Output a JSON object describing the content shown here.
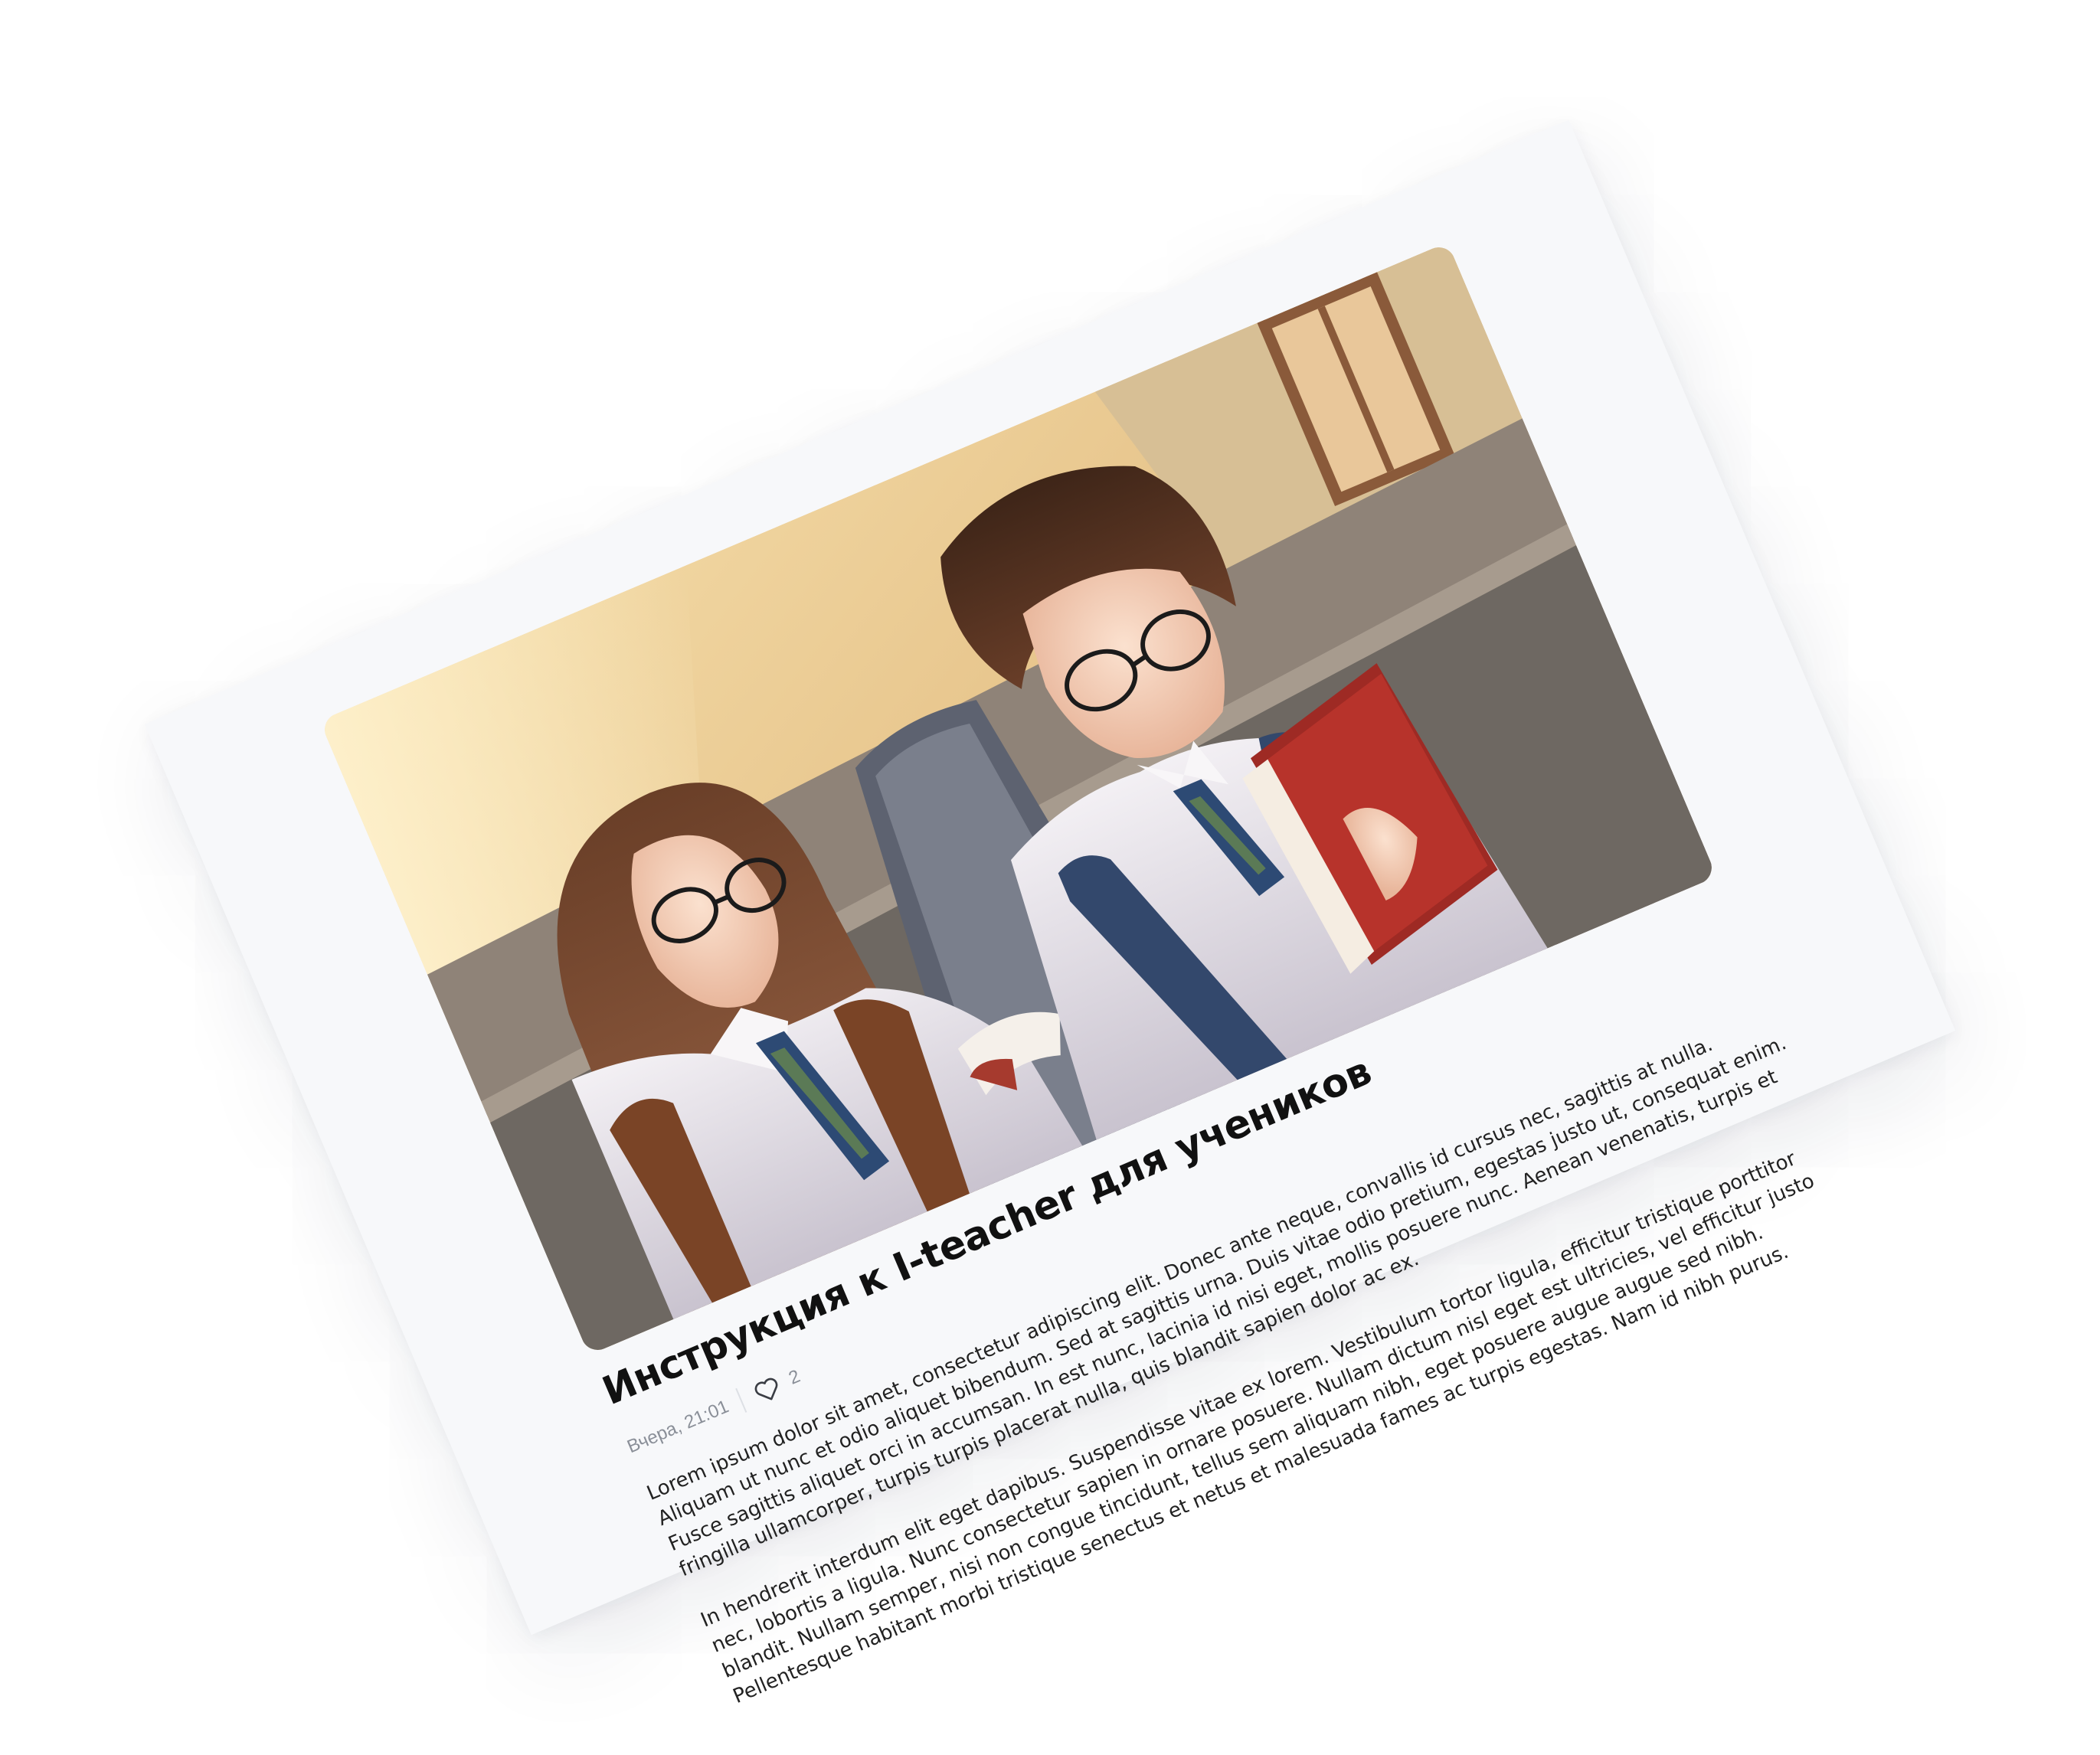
{
  "article": {
    "title": "Инструкция к I-teacher для учеников",
    "date": "Вчера, 21:01",
    "likes_count": "2",
    "paragraphs": [
      "Lorem ipsum dolor sit amet, consectetur adipiscing elit. Donec ante neque, convallis id cursus nec, sagittis at nulla. Aliquam ut nunc et odio aliquet bibendum. Sed at sagittis urna. Duis vitae odio pretium, egestas justo ut, consequat enim. Fusce sagittis aliquet orci in accumsan. In est nunc, lacinia id nisi eget, mollis posuere nunc. Aenean venenatis, turpis et fringilla ullamcorper, turpis turpis placerat nulla, quis blandit sapien dolor ac ex.",
      "In hendrerit interdum elit eget dapibus. Suspendisse vitae ex lorem. Vestibulum tortor ligula, efficitur tristique porttitor nec, lobortis a ligula. Nunc consectetur sapien in ornare posuere. Nullam dictum nisl eget est ultricies, vel efficitur justo blandit. Nullam semper, nisi non congue tincidunt, tellus sem aliquam nibh, eget posuere augue augue sed nibh. Pellentesque habitant morbi tristique senectus et netus et malesuada fames ac turpis egestas. Nam id nibh purus."
    ]
  },
  "icons": {
    "like": "heart-outline-icon"
  },
  "colors": {
    "card_background": "#f7f8fa",
    "title_text": "#111111",
    "meta_text": "#8a8f98",
    "body_text": "#222222"
  }
}
